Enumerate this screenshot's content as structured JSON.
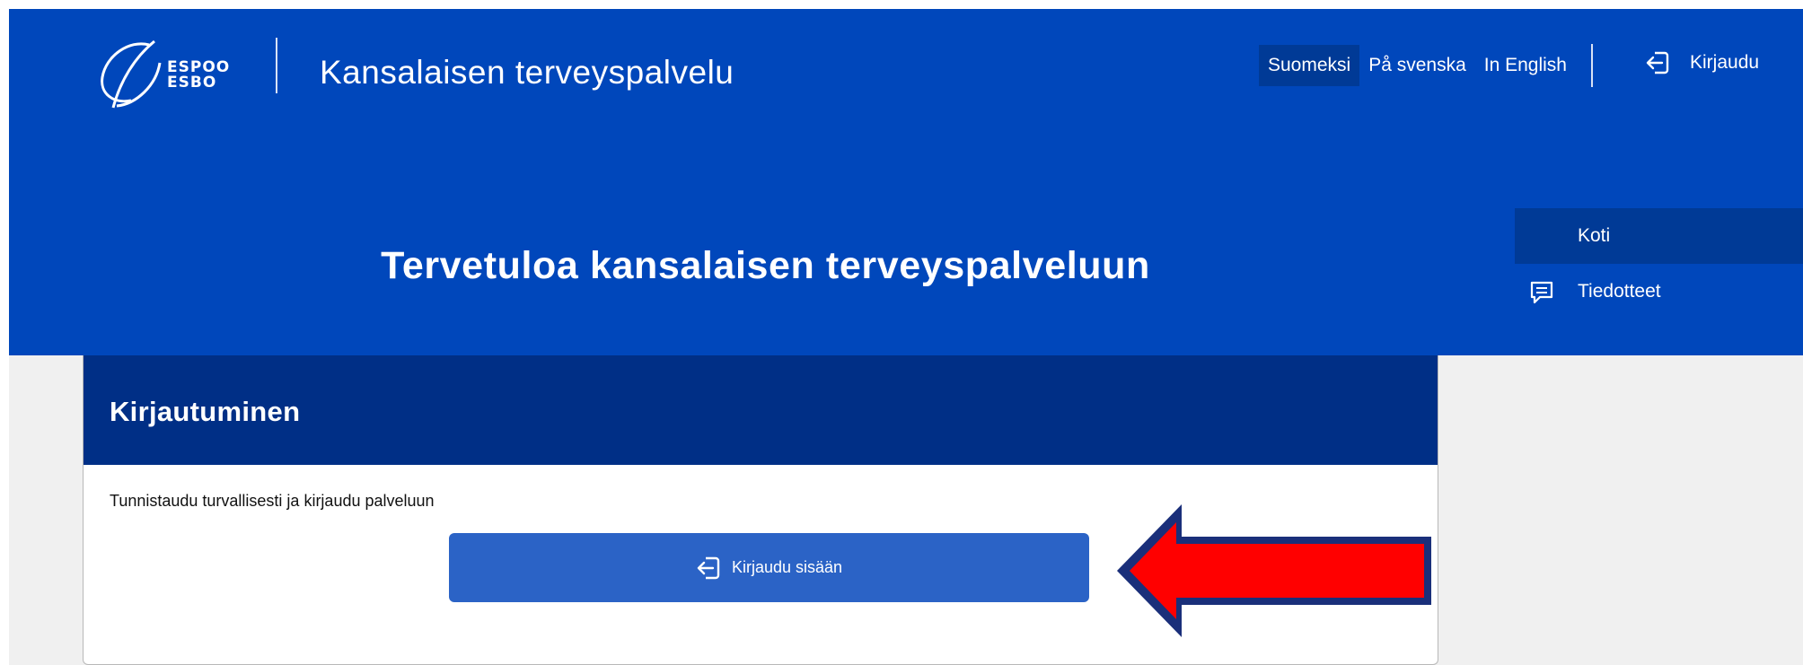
{
  "logo": {
    "line1": "ESPOO",
    "line2": "ESBO"
  },
  "header": {
    "title": "Kansalaisen terveyspalvelu",
    "languages": [
      {
        "label": "Suomeksi",
        "active": true
      },
      {
        "label": "På svenska",
        "active": false
      },
      {
        "label": "In English",
        "active": false
      }
    ],
    "login_label": "Kirjaudu"
  },
  "hero": {
    "welcome": "Tervetuloa kansalaisen terveyspalveluun"
  },
  "side_nav": {
    "items": [
      {
        "label": "Koti",
        "active": true,
        "icon": "none"
      },
      {
        "label": "Tiedotteet",
        "active": false,
        "icon": "message-icon"
      }
    ]
  },
  "login_card": {
    "title": "Kirjautuminen",
    "description": "Tunnistaudu turvallisesti ja kirjaudu palveluun",
    "button_label": "Kirjaudu sisään",
    "button_icon": "login-icon"
  },
  "annotation": {
    "icon": "red-arrow-left",
    "color": "#ff0000",
    "outline": "#1a2f7a"
  },
  "colors": {
    "brand_blue": "#0047bb",
    "dark_blue": "#002f86",
    "active_blue": "#003a96",
    "button_blue": "#2b63c6",
    "background": "#f0f0f0"
  }
}
